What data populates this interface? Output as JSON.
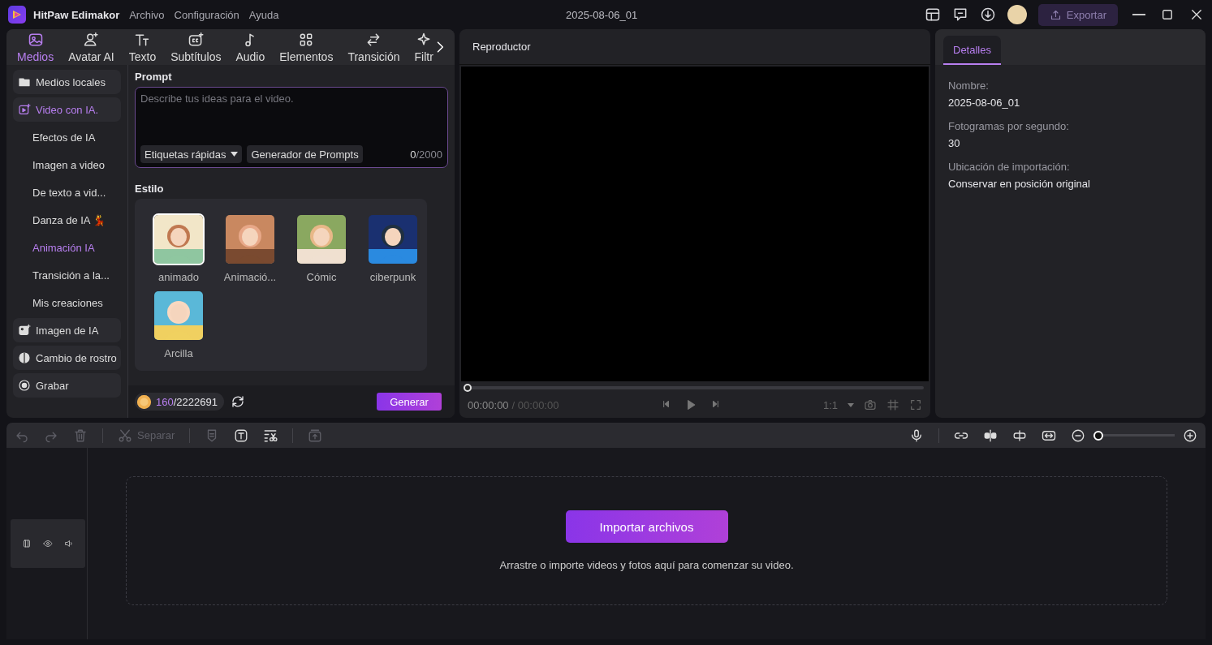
{
  "app": {
    "name": "HitPaw Edimakor",
    "menu": [
      "Archivo",
      "Configuración",
      "Ayuda"
    ],
    "project": "2025-08-06_01",
    "export": "Exportar"
  },
  "tabs": [
    {
      "label": "Medios",
      "selected": true
    },
    {
      "label": "Avatar AI",
      "selected": false
    },
    {
      "label": "Texto",
      "selected": false
    },
    {
      "label": "Subtítulos",
      "selected": false
    },
    {
      "label": "Audio",
      "selected": false
    },
    {
      "label": "Elementos",
      "selected": false
    },
    {
      "label": "Transición",
      "selected": false
    },
    {
      "label": "Filtr",
      "selected": false
    }
  ],
  "sidebar": {
    "items": [
      {
        "label": "Medios locales",
        "kind": "main",
        "selected": false
      },
      {
        "label": "Video con IA.",
        "kind": "main",
        "selected": true
      },
      {
        "label": "Efectos de IA",
        "kind": "sub",
        "selected": false
      },
      {
        "label": "Imagen a video",
        "kind": "sub",
        "selected": false
      },
      {
        "label": "De texto a vid...",
        "kind": "sub",
        "selected": false
      },
      {
        "label": "Danza de IA 💃",
        "kind": "sub",
        "selected": false
      },
      {
        "label": "Animación IA",
        "kind": "sub",
        "selected": true
      },
      {
        "label": "Transición a la...",
        "kind": "sub",
        "selected": false
      },
      {
        "label": "Mis creaciones",
        "kind": "sub",
        "selected": false
      },
      {
        "label": "Imagen de IA",
        "kind": "main",
        "selected": false
      },
      {
        "label": "Cambio de rostro",
        "kind": "main",
        "selected": false
      },
      {
        "label": "Grabar",
        "kind": "main",
        "selected": false
      }
    ]
  },
  "prompt": {
    "title": "Prompt",
    "placeholder": "Describe tus ideas para el video.",
    "tags": "Etiquetas rápidas",
    "generator": "Generador de Prompts",
    "count": "0",
    "max": "/2000"
  },
  "style": {
    "title": "Estilo",
    "items": [
      {
        "label": "animado",
        "selected": true
      },
      {
        "label": "Animació...",
        "selected": false
      },
      {
        "label": "Cómic",
        "selected": false
      },
      {
        "label": "ciberpunk",
        "selected": false
      },
      {
        "label": "Arcilla",
        "selected": false
      }
    ]
  },
  "credits": {
    "used": "160",
    "total": "/2222691",
    "generate": "Generar"
  },
  "player": {
    "title": "Reproductor",
    "level": 0,
    "time": "00:00:00",
    "duration": "/ 00:00:00",
    "ratio": "1:1"
  },
  "details": {
    "tab": {
      "label": "Detalles",
      "selected": true
    },
    "fields": [
      {
        "label": "Nombre:",
        "value": "2025-08-06_01"
      },
      {
        "label": "Fotogramas por segundo:",
        "value": "30"
      },
      {
        "label": "Ubicación de importación:",
        "value": "Conservar en posición original"
      }
    ]
  },
  "toolbar": {
    "left": [
      {
        "disabled": true
      },
      {
        "disabled": true
      },
      {
        "disabled": true
      },
      {
        "label": "Separar",
        "disabled": true
      },
      {
        "disabled": true
      },
      {
        "disabled": false
      },
      {
        "disabled": false
      },
      {
        "disabled": true
      }
    ],
    "zoom": {
      "level": 0
    }
  },
  "timeline": {
    "import": "Importar archivos",
    "hint": "Arrastre o importe videos y fotos aquí para comenzar su video."
  }
}
